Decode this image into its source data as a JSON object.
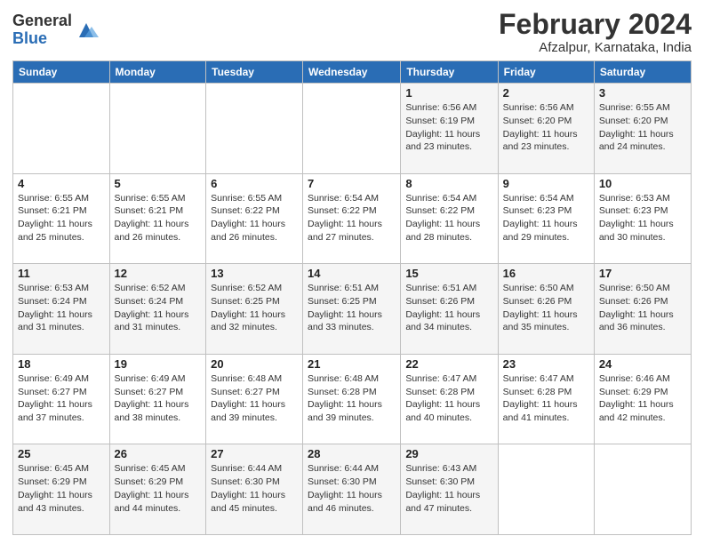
{
  "logo": {
    "general": "General",
    "blue": "Blue"
  },
  "title": "February 2024",
  "subtitle": "Afzalpur, Karnataka, India",
  "days_header": [
    "Sunday",
    "Monday",
    "Tuesday",
    "Wednesday",
    "Thursday",
    "Friday",
    "Saturday"
  ],
  "weeks": [
    [
      {
        "day": "",
        "info": ""
      },
      {
        "day": "",
        "info": ""
      },
      {
        "day": "",
        "info": ""
      },
      {
        "day": "",
        "info": ""
      },
      {
        "day": "1",
        "info": "Sunrise: 6:56 AM\nSunset: 6:19 PM\nDaylight: 11 hours\nand 23 minutes."
      },
      {
        "day": "2",
        "info": "Sunrise: 6:56 AM\nSunset: 6:20 PM\nDaylight: 11 hours\nand 23 minutes."
      },
      {
        "day": "3",
        "info": "Sunrise: 6:55 AM\nSunset: 6:20 PM\nDaylight: 11 hours\nand 24 minutes."
      }
    ],
    [
      {
        "day": "4",
        "info": "Sunrise: 6:55 AM\nSunset: 6:21 PM\nDaylight: 11 hours\nand 25 minutes."
      },
      {
        "day": "5",
        "info": "Sunrise: 6:55 AM\nSunset: 6:21 PM\nDaylight: 11 hours\nand 26 minutes."
      },
      {
        "day": "6",
        "info": "Sunrise: 6:55 AM\nSunset: 6:22 PM\nDaylight: 11 hours\nand 26 minutes."
      },
      {
        "day": "7",
        "info": "Sunrise: 6:54 AM\nSunset: 6:22 PM\nDaylight: 11 hours\nand 27 minutes."
      },
      {
        "day": "8",
        "info": "Sunrise: 6:54 AM\nSunset: 6:22 PM\nDaylight: 11 hours\nand 28 minutes."
      },
      {
        "day": "9",
        "info": "Sunrise: 6:54 AM\nSunset: 6:23 PM\nDaylight: 11 hours\nand 29 minutes."
      },
      {
        "day": "10",
        "info": "Sunrise: 6:53 AM\nSunset: 6:23 PM\nDaylight: 11 hours\nand 30 minutes."
      }
    ],
    [
      {
        "day": "11",
        "info": "Sunrise: 6:53 AM\nSunset: 6:24 PM\nDaylight: 11 hours\nand 31 minutes."
      },
      {
        "day": "12",
        "info": "Sunrise: 6:52 AM\nSunset: 6:24 PM\nDaylight: 11 hours\nand 31 minutes."
      },
      {
        "day": "13",
        "info": "Sunrise: 6:52 AM\nSunset: 6:25 PM\nDaylight: 11 hours\nand 32 minutes."
      },
      {
        "day": "14",
        "info": "Sunrise: 6:51 AM\nSunset: 6:25 PM\nDaylight: 11 hours\nand 33 minutes."
      },
      {
        "day": "15",
        "info": "Sunrise: 6:51 AM\nSunset: 6:26 PM\nDaylight: 11 hours\nand 34 minutes."
      },
      {
        "day": "16",
        "info": "Sunrise: 6:50 AM\nSunset: 6:26 PM\nDaylight: 11 hours\nand 35 minutes."
      },
      {
        "day": "17",
        "info": "Sunrise: 6:50 AM\nSunset: 6:26 PM\nDaylight: 11 hours\nand 36 minutes."
      }
    ],
    [
      {
        "day": "18",
        "info": "Sunrise: 6:49 AM\nSunset: 6:27 PM\nDaylight: 11 hours\nand 37 minutes."
      },
      {
        "day": "19",
        "info": "Sunrise: 6:49 AM\nSunset: 6:27 PM\nDaylight: 11 hours\nand 38 minutes."
      },
      {
        "day": "20",
        "info": "Sunrise: 6:48 AM\nSunset: 6:27 PM\nDaylight: 11 hours\nand 39 minutes."
      },
      {
        "day": "21",
        "info": "Sunrise: 6:48 AM\nSunset: 6:28 PM\nDaylight: 11 hours\nand 39 minutes."
      },
      {
        "day": "22",
        "info": "Sunrise: 6:47 AM\nSunset: 6:28 PM\nDaylight: 11 hours\nand 40 minutes."
      },
      {
        "day": "23",
        "info": "Sunrise: 6:47 AM\nSunset: 6:28 PM\nDaylight: 11 hours\nand 41 minutes."
      },
      {
        "day": "24",
        "info": "Sunrise: 6:46 AM\nSunset: 6:29 PM\nDaylight: 11 hours\nand 42 minutes."
      }
    ],
    [
      {
        "day": "25",
        "info": "Sunrise: 6:45 AM\nSunset: 6:29 PM\nDaylight: 11 hours\nand 43 minutes."
      },
      {
        "day": "26",
        "info": "Sunrise: 6:45 AM\nSunset: 6:29 PM\nDaylight: 11 hours\nand 44 minutes."
      },
      {
        "day": "27",
        "info": "Sunrise: 6:44 AM\nSunset: 6:30 PM\nDaylight: 11 hours\nand 45 minutes."
      },
      {
        "day": "28",
        "info": "Sunrise: 6:44 AM\nSunset: 6:30 PM\nDaylight: 11 hours\nand 46 minutes."
      },
      {
        "day": "29",
        "info": "Sunrise: 6:43 AM\nSunset: 6:30 PM\nDaylight: 11 hours\nand 47 minutes."
      },
      {
        "day": "",
        "info": ""
      },
      {
        "day": "",
        "info": ""
      }
    ]
  ]
}
